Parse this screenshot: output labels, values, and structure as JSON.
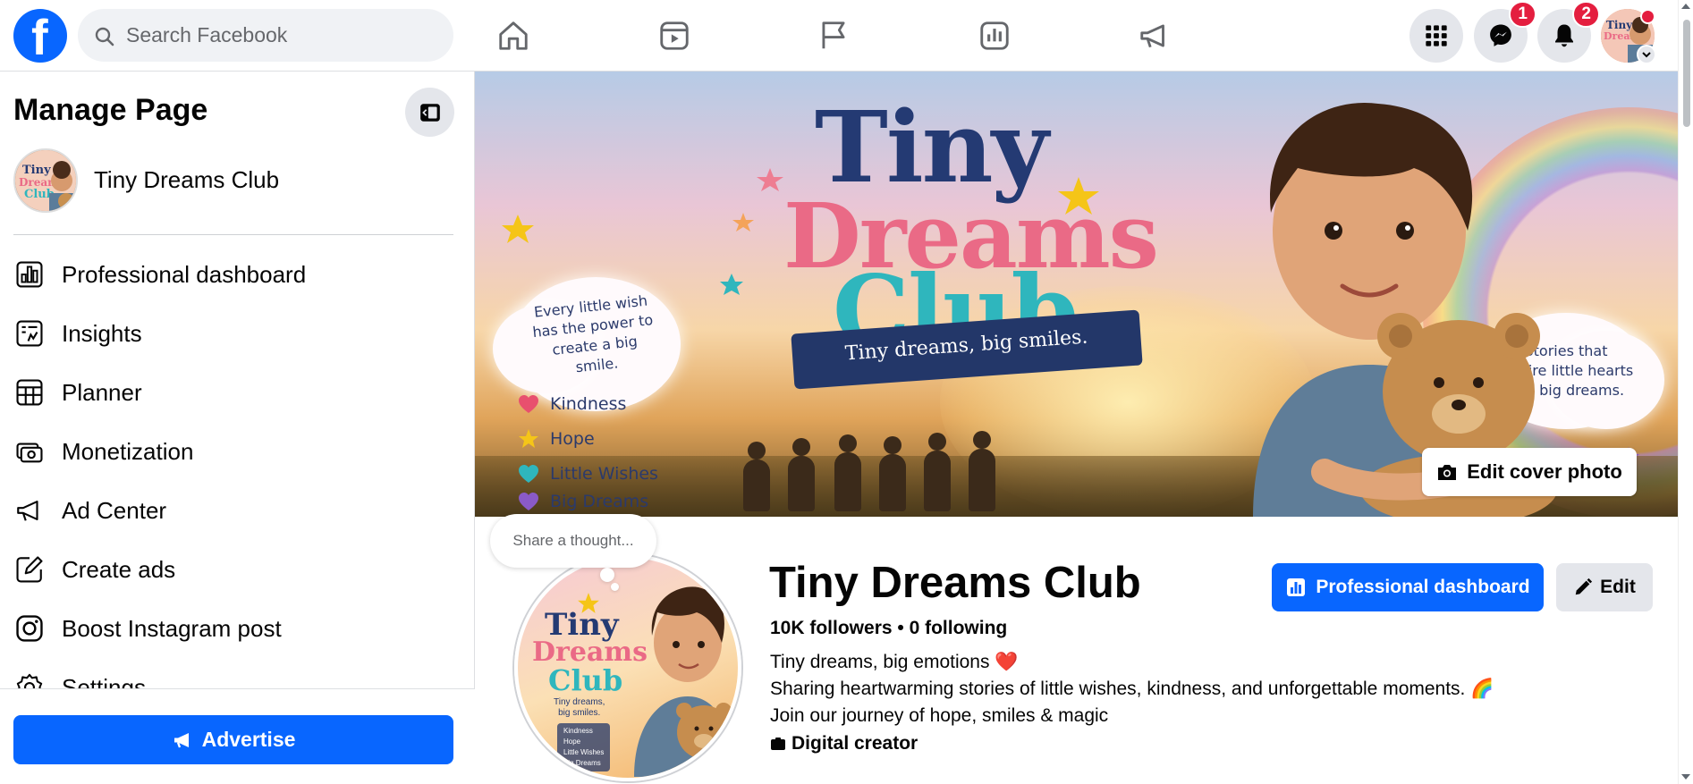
{
  "topbar": {
    "logo_letter": "f",
    "search": {
      "placeholder": "Search Facebook"
    },
    "nav_icons": [
      "home-icon",
      "reels-icon",
      "flag-icon",
      "dashboard-icon",
      "megaphone-icon"
    ],
    "menu_icon": "grid-menu-icon",
    "messenger": {
      "icon": "messenger-icon",
      "badge": "1"
    },
    "notifications": {
      "icon": "bell-icon",
      "badge": "2"
    }
  },
  "sidebar": {
    "title": "Manage Page",
    "page_name": "Tiny Dreams Club",
    "items": [
      {
        "label": "Professional dashboard",
        "icon": "chart-icon"
      },
      {
        "label": "Insights",
        "icon": "insights-icon"
      },
      {
        "label": "Planner",
        "icon": "calendar-icon"
      },
      {
        "label": "Monetization",
        "icon": "money-icon"
      },
      {
        "label": "Ad Center",
        "icon": "megaphone-icon"
      },
      {
        "label": "Create ads",
        "icon": "pencil-square-icon"
      },
      {
        "label": "Boost Instagram post",
        "icon": "instagram-icon"
      },
      {
        "label": "Settings",
        "icon": "gear-icon"
      }
    ],
    "advertise_label": "Advertise"
  },
  "cover": {
    "brand_line1": "Tiny",
    "brand_line2": "Dreams",
    "brand_line3": "Club",
    "tagline": "Tiny dreams, big smiles.",
    "cloud_left": [
      "Every little wish",
      "has the power to",
      "create a big",
      "smile."
    ],
    "cloud_right": [
      "Stories that",
      "inspire little hearts",
      "and big dreams."
    ],
    "values": [
      {
        "label": "Kindness",
        "color": "#e8506e",
        "shape": "heart"
      },
      {
        "label": "Hope",
        "color": "#f5c518",
        "shape": "star"
      },
      {
        "label": "Little Wishes",
        "color": "#2fb6bd",
        "shape": "heart"
      },
      {
        "label": "Big Dreams",
        "color": "#8a5ac8",
        "shape": "heart"
      }
    ],
    "edit_cover_label": "Edit cover photo"
  },
  "profile": {
    "thought_placeholder": "Share a thought...",
    "picture_text": {
      "line1": "Tiny",
      "line2": "Dreams",
      "line3": "Club",
      "tagline": "Tiny dreams,\nbig smiles.",
      "list": [
        "Kindness",
        "Hope",
        "Little Wishes",
        "Big Dreams"
      ]
    },
    "name": "Tiny Dreams Club",
    "followers": "10K followers",
    "following": "0 following",
    "bio": [
      "Tiny dreams, big emotions ❤️",
      "Sharing heartwarming stories of little wishes, kindness, and unforgettable moments. 🌈",
      "Join our journey of hope, smiles & magic"
    ],
    "category": "Digital creator",
    "professional_dashboard_label": "Professional dashboard",
    "edit_label": "Edit"
  },
  "colors": {
    "brand_blue": "#0866ff",
    "badge_red": "#e41e3f",
    "gray_button": "#e4e6eb"
  }
}
